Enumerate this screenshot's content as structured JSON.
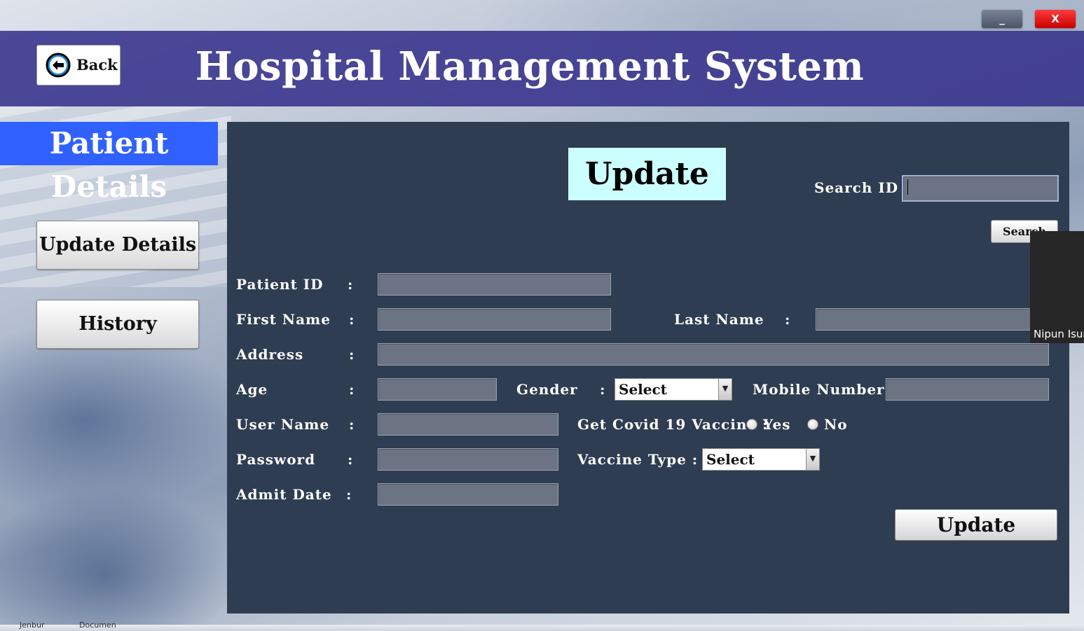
{
  "window": {
    "minimize_label": "_",
    "close_label": "X"
  },
  "header": {
    "back_label": "Back",
    "app_title": "Hospital Management System"
  },
  "sidebar": {
    "section_title": "Patient Details",
    "buttons": [
      {
        "label": "Update Details"
      },
      {
        "label": "History"
      }
    ]
  },
  "form": {
    "heading": "Update",
    "search_label": "Search ID :",
    "search_button": "Search",
    "colon": ":",
    "labels": {
      "patient_id": "Patient ID",
      "first_name": "First Name",
      "last_name": "Last Name",
      "address": "Address",
      "age": "Age",
      "gender": "Gender",
      "mobile": "Mobile Number :",
      "user_name": "User Name",
      "covid_vaccine": "Get Covid 19 Vaccine :",
      "password": "Password",
      "vaccine_type": "Vaccine Type :",
      "admit_date": "Admit Date"
    },
    "gender_select": "Select",
    "vaccine_select": "Select",
    "radio_yes": "Yes",
    "radio_no": "No",
    "submit_label": "Update"
  },
  "overlay": {
    "participant_name": "Nipun Isur"
  },
  "taskbar": {
    "item1": "Jenbur",
    "item2": "Documen"
  }
}
